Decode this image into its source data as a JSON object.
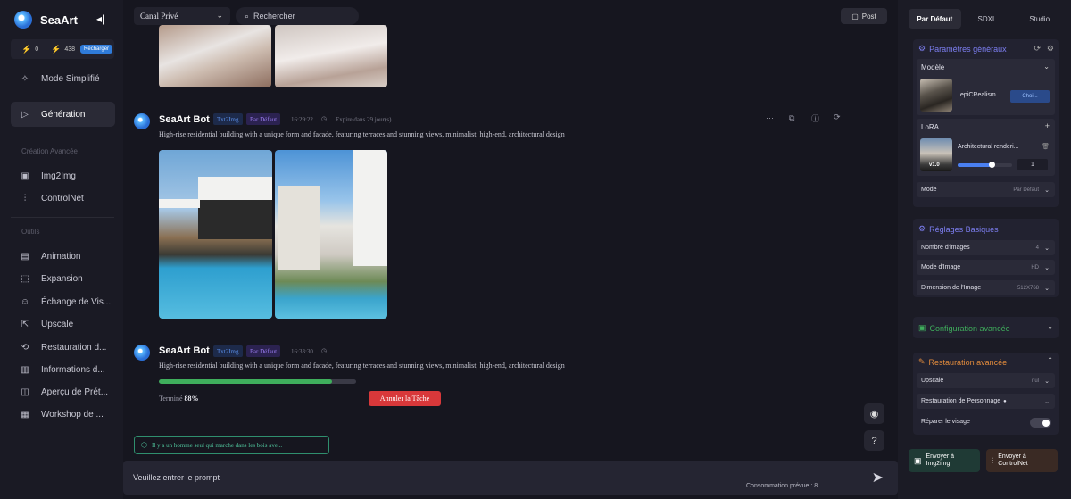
{
  "sidebar": {
    "brand": "SeaArt",
    "credits": {
      "stamina": "0",
      "lightning": "438",
      "recharge_label": "Recharger"
    },
    "items": [
      {
        "label": "Mode Simplifié",
        "icon": "sparkle-icon"
      },
      {
        "label": "Génération",
        "icon": "play-icon",
        "active": true
      }
    ],
    "section_creation": "Création Avancée",
    "creation_items": [
      {
        "label": "Img2Img",
        "icon": "image-icon"
      },
      {
        "label": "ControlNet",
        "icon": "sliders-icon"
      }
    ],
    "section_tools": "Outils",
    "tool_items": [
      {
        "label": "Animation",
        "icon": "film-icon"
      },
      {
        "label": "Expansion",
        "icon": "expand-icon"
      },
      {
        "label": "Échange de Vis...",
        "icon": "face-swap-icon"
      },
      {
        "label": "Upscale",
        "icon": "upscale-icon"
      },
      {
        "label": "Restauration d...",
        "icon": "restore-icon"
      },
      {
        "label": "Informations d...",
        "icon": "info-book-icon"
      },
      {
        "label": "Aperçu de Prét...",
        "icon": "preview-icon"
      },
      {
        "label": "Workshop de ...",
        "icon": "workshop-icon"
      }
    ]
  },
  "topbar": {
    "channel": "Canal Privé",
    "search_placeholder": "Rechercher",
    "post_label": "Post"
  },
  "messages": [
    {
      "name": "SeaArt Bot",
      "tag1": "Txt2Img",
      "tag2": "Par Défaut",
      "time": "16:29:22",
      "expires": "Expire dans 29 jour(s)",
      "prompt": "High-rise residential building with a unique form and facade, featuring terraces and stunning views, minimalist, high-end, architectural design"
    },
    {
      "name": "SeaArt Bot",
      "tag1": "Txt2Img",
      "tag2": "Par Défaut",
      "time": "16:33:30",
      "prompt": "High-rise residential building with a unique form and facade, featuring terraces and stunning views, minimalist, high-end, architectural design",
      "status_label": "Terminé",
      "progress_text": "88%",
      "progress": 0.88,
      "cancel_label": "Annuler la Tâche"
    }
  ],
  "suggestion": "Il y a un homme seul qui marche dans les bois ave...",
  "prompt_placeholder": "Veuillez entrer le prompt",
  "consumption": "Consommation prévue : 8",
  "help_label": "?",
  "rpanel": {
    "tabs": [
      "Par Défaut",
      "SDXL",
      "Studio"
    ],
    "general_title": "Paramètres généraux",
    "model_label": "Modèle",
    "model_name": "epiCRealism",
    "model_choose": "Choi...",
    "lora_label": "LoRA",
    "lora_name": "Architectural renderi...",
    "lora_version": "v1.0",
    "lora_weight": "1",
    "lora_weight_fraction": 0.62,
    "mode_label": "Mode",
    "mode_value": "Par Défaut",
    "basic_title": "Réglages Basiques",
    "basic_rows": [
      {
        "label": "Nombre d'images",
        "value": "4"
      },
      {
        "label": "Mode d'Image",
        "value": "HD"
      },
      {
        "label": "Dimension de l'Image",
        "value": "512X768"
      }
    ],
    "advanced_config_title": "Configuration avancée",
    "restore_title": "Restauration avancée",
    "upscale_label": "Upscale",
    "upscale_value": "nul",
    "face_restore_label": "Restauration de Personnage",
    "face_fix_label": "Réparer le visage",
    "send_img2img": "Envoyer à\nImg2img",
    "send_controlnet": "Envoyer à\nControlNet",
    "colors": {
      "accent": "#7c7ef0",
      "green": "#3fae5c",
      "cancel": "#d8383a",
      "orange": "#e08a3c"
    }
  }
}
